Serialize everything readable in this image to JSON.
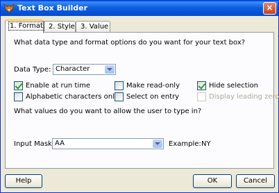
{
  "window": {
    "title": "Text Box Builder",
    "close_label": "×"
  },
  "tabs": [
    {
      "label": "1. Format",
      "active": true
    },
    {
      "label": "2. Style",
      "active": false
    },
    {
      "label": "3. Value",
      "active": false
    }
  ],
  "format": {
    "question": "What data type and format options do you want for your text box?",
    "data_type_label": "Data Type:",
    "data_type_value": "Character",
    "options": {
      "enable_at_runtime": {
        "label": "Enable at run time",
        "checked": true,
        "enabled": true
      },
      "alphabetic_only": {
        "label": "Alphabetic characters only",
        "checked": false,
        "enabled": true
      },
      "make_read_only": {
        "label": "Make read-only",
        "checked": false,
        "enabled": true
      },
      "select_on_entry": {
        "label": "Select on entry",
        "checked": false,
        "enabled": true
      },
      "hide_selection": {
        "label": "Hide selection",
        "checked": true,
        "enabled": true
      },
      "display_leading_zeros": {
        "label": "Display leading zeros",
        "checked": false,
        "enabled": false
      }
    },
    "values_question": "What values do you want to allow the user to type in?",
    "input_mask_label": "Input Mask:",
    "input_mask_value": "AA",
    "example_label": "Example:",
    "example_value": "NY"
  },
  "buttons": {
    "help": "Help",
    "ok": "OK",
    "cancel": "Cancel"
  }
}
